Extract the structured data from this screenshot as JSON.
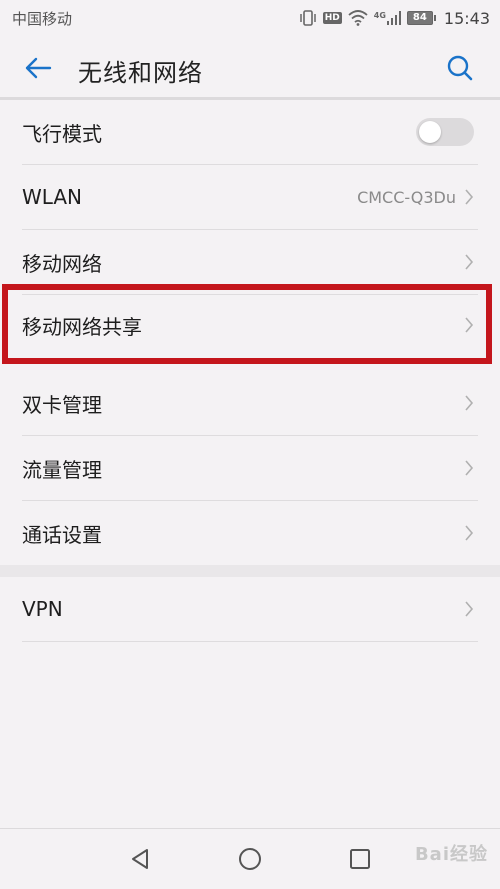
{
  "status_bar": {
    "carrier": "中国移动",
    "network_type": "4G",
    "hd_label": "HD",
    "battery_percent": "84",
    "time": "15:43",
    "icons": [
      "vibrate-icon",
      "hd-icon",
      "wifi-icon",
      "signal-icon",
      "battery-icon"
    ]
  },
  "app_bar": {
    "title": "无线和网络",
    "back_icon": "back-arrow-icon",
    "search_icon": "search-icon"
  },
  "rows": [
    {
      "label": "飞行模式",
      "type": "toggle",
      "toggle_on": false
    },
    {
      "label": "WLAN",
      "value": "CMCC-Q3Du",
      "type": "link"
    },
    {
      "label": "移动网络",
      "type": "link"
    },
    {
      "label": "移动网络共享",
      "type": "link",
      "highlighted": true
    },
    {
      "label": "双卡管理",
      "type": "link"
    },
    {
      "label": "流量管理",
      "type": "link"
    },
    {
      "label": "通话设置",
      "type": "link"
    },
    {
      "label": "VPN",
      "type": "link"
    }
  ],
  "nav_bar": {
    "back_icon": "nav-back-icon",
    "home_icon": "nav-home-icon",
    "recents_icon": "nav-recents-icon"
  },
  "watermark": "Bai经验",
  "colors": {
    "accent": "#1a73c9",
    "highlight": "#c4161c",
    "background": "#f4f2f4",
    "divider": "#dedcde"
  }
}
